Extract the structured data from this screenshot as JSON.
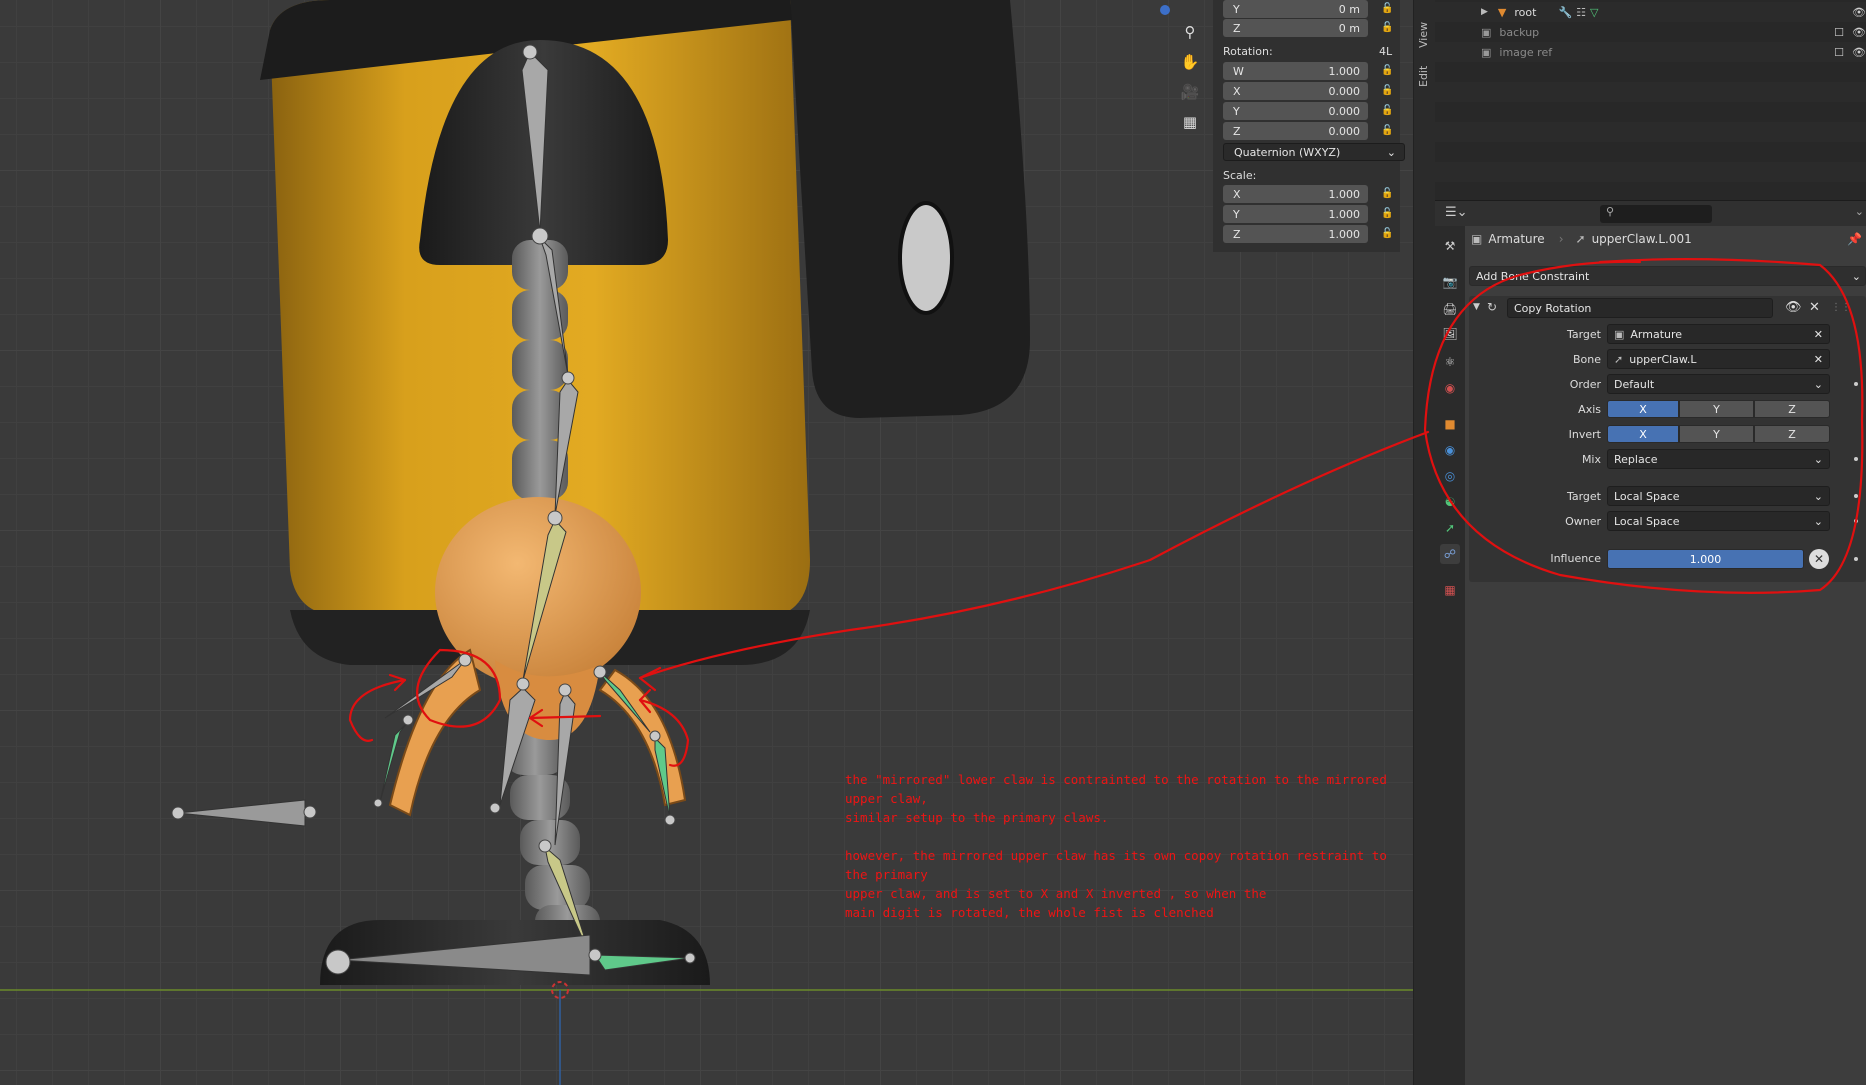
{
  "npanel": {
    "loc_y_label": "Y",
    "loc_y_value": "0 m",
    "loc_z_label": "Z",
    "loc_z_value": "0 m",
    "rotation_label": "Rotation:",
    "rotation_mode_short": "4L",
    "rot_w_label": "W",
    "rot_w_value": "1.000",
    "rot_x_label": "X",
    "rot_x_value": "0.000",
    "rot_y_label": "Y",
    "rot_y_value": "0.000",
    "rot_z_label": "Z",
    "rot_z_value": "0.000",
    "rotation_mode": "Quaternion (WXYZ)",
    "scale_label": "Scale:",
    "scale_x_label": "X",
    "scale_x_value": "1.000",
    "scale_y_label": "Y",
    "scale_y_value": "1.000",
    "scale_z_label": "Z",
    "scale_z_value": "1.000"
  },
  "ntabs": {
    "view": "View",
    "edit": "Edit"
  },
  "outliner": {
    "items": [
      {
        "label": "root"
      },
      {
        "label": "backup"
      },
      {
        "label": "image ref"
      }
    ]
  },
  "props": {
    "breadcrumb_armature": "Armature",
    "breadcrumb_bone": "upperClaw.L.001",
    "add_constraint": "Add Bone Constraint",
    "constraint_name": "Copy Rotation",
    "target_label": "Target",
    "target_value": "Armature",
    "bone_label": "Bone",
    "bone_value": "upperClaw.L",
    "order_label": "Order",
    "order_value": "Default",
    "axis_label": "Axis",
    "axis_x": "X",
    "axis_y": "Y",
    "axis_z": "Z",
    "invert_label": "Invert",
    "invert_x": "X",
    "invert_y": "Y",
    "invert_z": "Z",
    "mix_label": "Mix",
    "mix_value": "Replace",
    "target_space_label": "Target",
    "target_space_value": "Local Space",
    "owner_space_label": "Owner",
    "owner_space_value": "Local Space",
    "influence_label": "Influence",
    "influence_value": "1.000"
  },
  "annotation": {
    "line1": "the \"mirrored\" lower claw is contrainted to the rotation to the mirrored upper claw,",
    "line2": "similar setup to the primary claws.",
    "line3": "however, the mirrored upper claw has its own copoy rotation restraint to the primary",
    "line4": "upper claw, and is set to X and X inverted , so when the",
    "line5": "main digit is rotated, the whole fist is clenched"
  },
  "colors": {
    "accent_blue": "#4772b3",
    "annotation_red": "#ee1414",
    "body_yellow": "#d9a21a",
    "selected_bone_green": "#5fc98a"
  }
}
